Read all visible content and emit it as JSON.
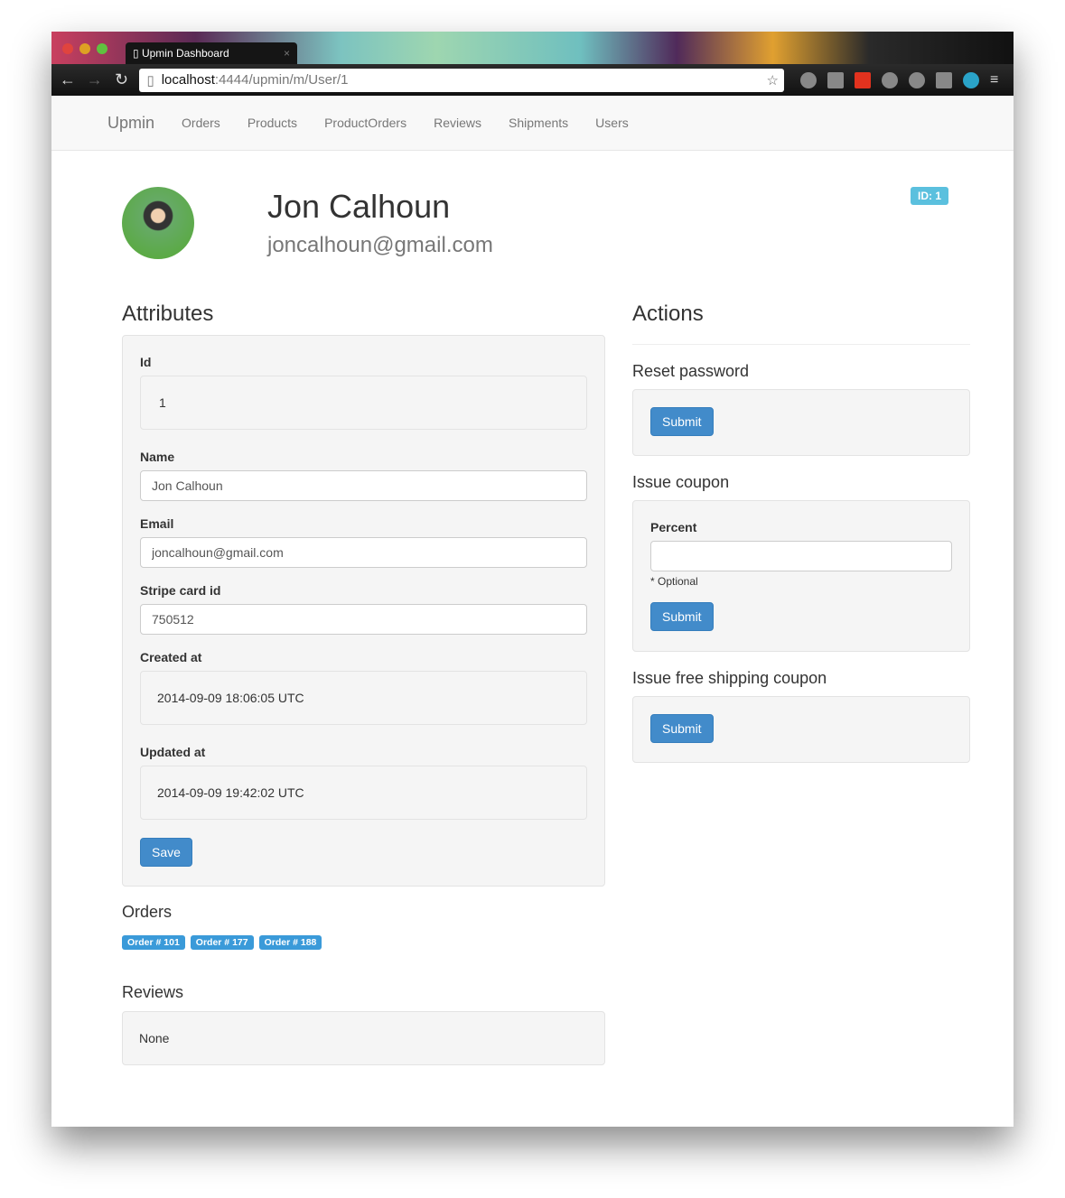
{
  "browser": {
    "tab_title": "Upmin Dashboard",
    "url_host": "localhost",
    "url_path": ":4444/upmin/m/User/1"
  },
  "nav": {
    "brand": "Upmin",
    "items": [
      "Orders",
      "Products",
      "ProductOrders",
      "Reviews",
      "Shipments",
      "Users"
    ]
  },
  "profile": {
    "name": "Jon Calhoun",
    "email": "joncalhoun@gmail.com",
    "id_badge": "ID: 1"
  },
  "attributes": {
    "title": "Attributes",
    "id_label": "Id",
    "id_value": "1",
    "name_label": "Name",
    "name_value": "Jon Calhoun",
    "email_label": "Email",
    "email_value": "joncalhoun@gmail.com",
    "stripe_label": "Stripe card id",
    "stripe_value": "750512",
    "created_label": "Created at",
    "created_value": "2014-09-09 18:06:05 UTC",
    "updated_label": "Updated at",
    "updated_value": "2014-09-09 19:42:02 UTC",
    "save": "Save"
  },
  "orders": {
    "title": "Orders",
    "items": [
      "Order # 101",
      "Order # 177",
      "Order # 188"
    ]
  },
  "reviews": {
    "title": "Reviews",
    "value": "None"
  },
  "actions": {
    "title": "Actions",
    "reset": {
      "title": "Reset password",
      "submit": "Submit"
    },
    "coupon": {
      "title": "Issue coupon",
      "percent_label": "Percent",
      "percent_value": "",
      "hint": "* Optional",
      "submit": "Submit"
    },
    "shipping": {
      "title": "Issue free shipping coupon",
      "submit": "Submit"
    }
  }
}
